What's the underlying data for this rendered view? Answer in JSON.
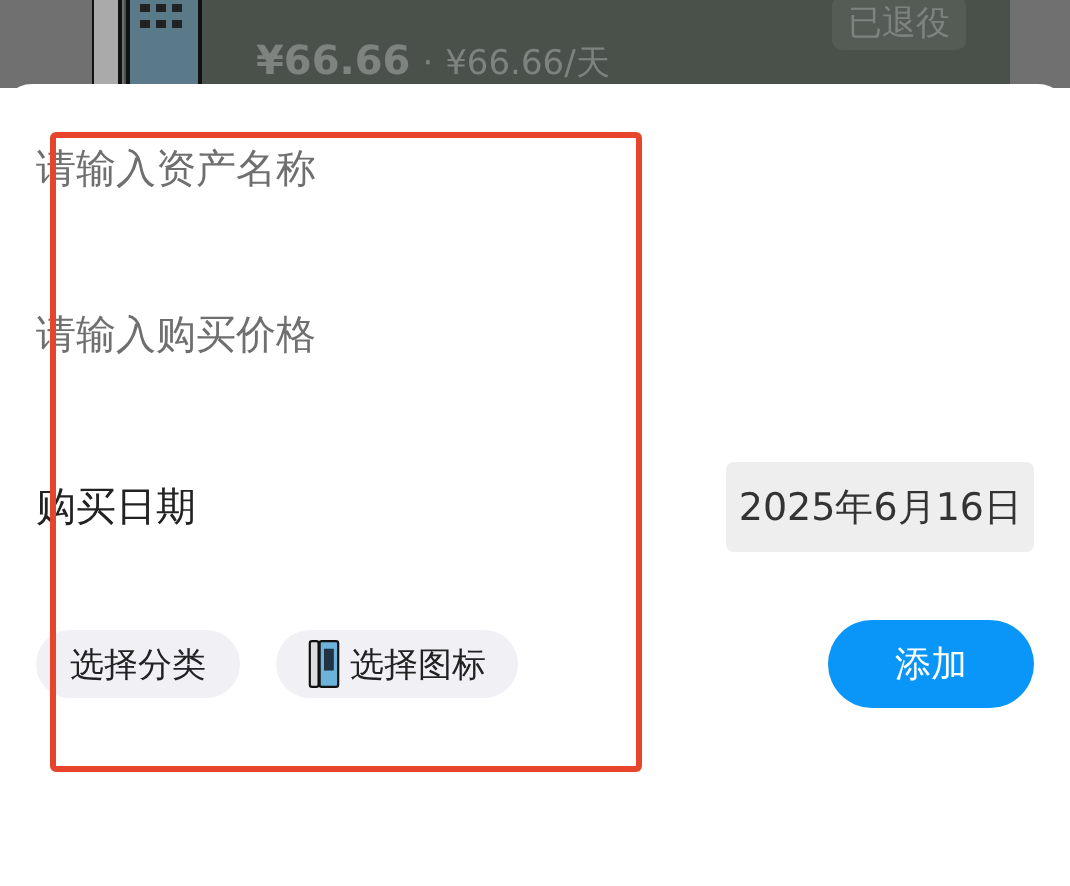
{
  "background_card": {
    "price": "¥66.66",
    "daily_cost": "¥66.66/天",
    "separator": "·",
    "status": "已退役"
  },
  "form": {
    "name_field": {
      "placeholder": "请输入资产名称"
    },
    "price_field": {
      "placeholder": "请输入购买价格"
    },
    "date_row": {
      "label": "购买日期",
      "value": "2025年6月16日"
    },
    "chips": [
      {
        "label": "选择分类",
        "icon": false
      },
      {
        "label": "选择图标",
        "icon": true
      }
    ],
    "submit": "添加"
  },
  "highlight": true
}
